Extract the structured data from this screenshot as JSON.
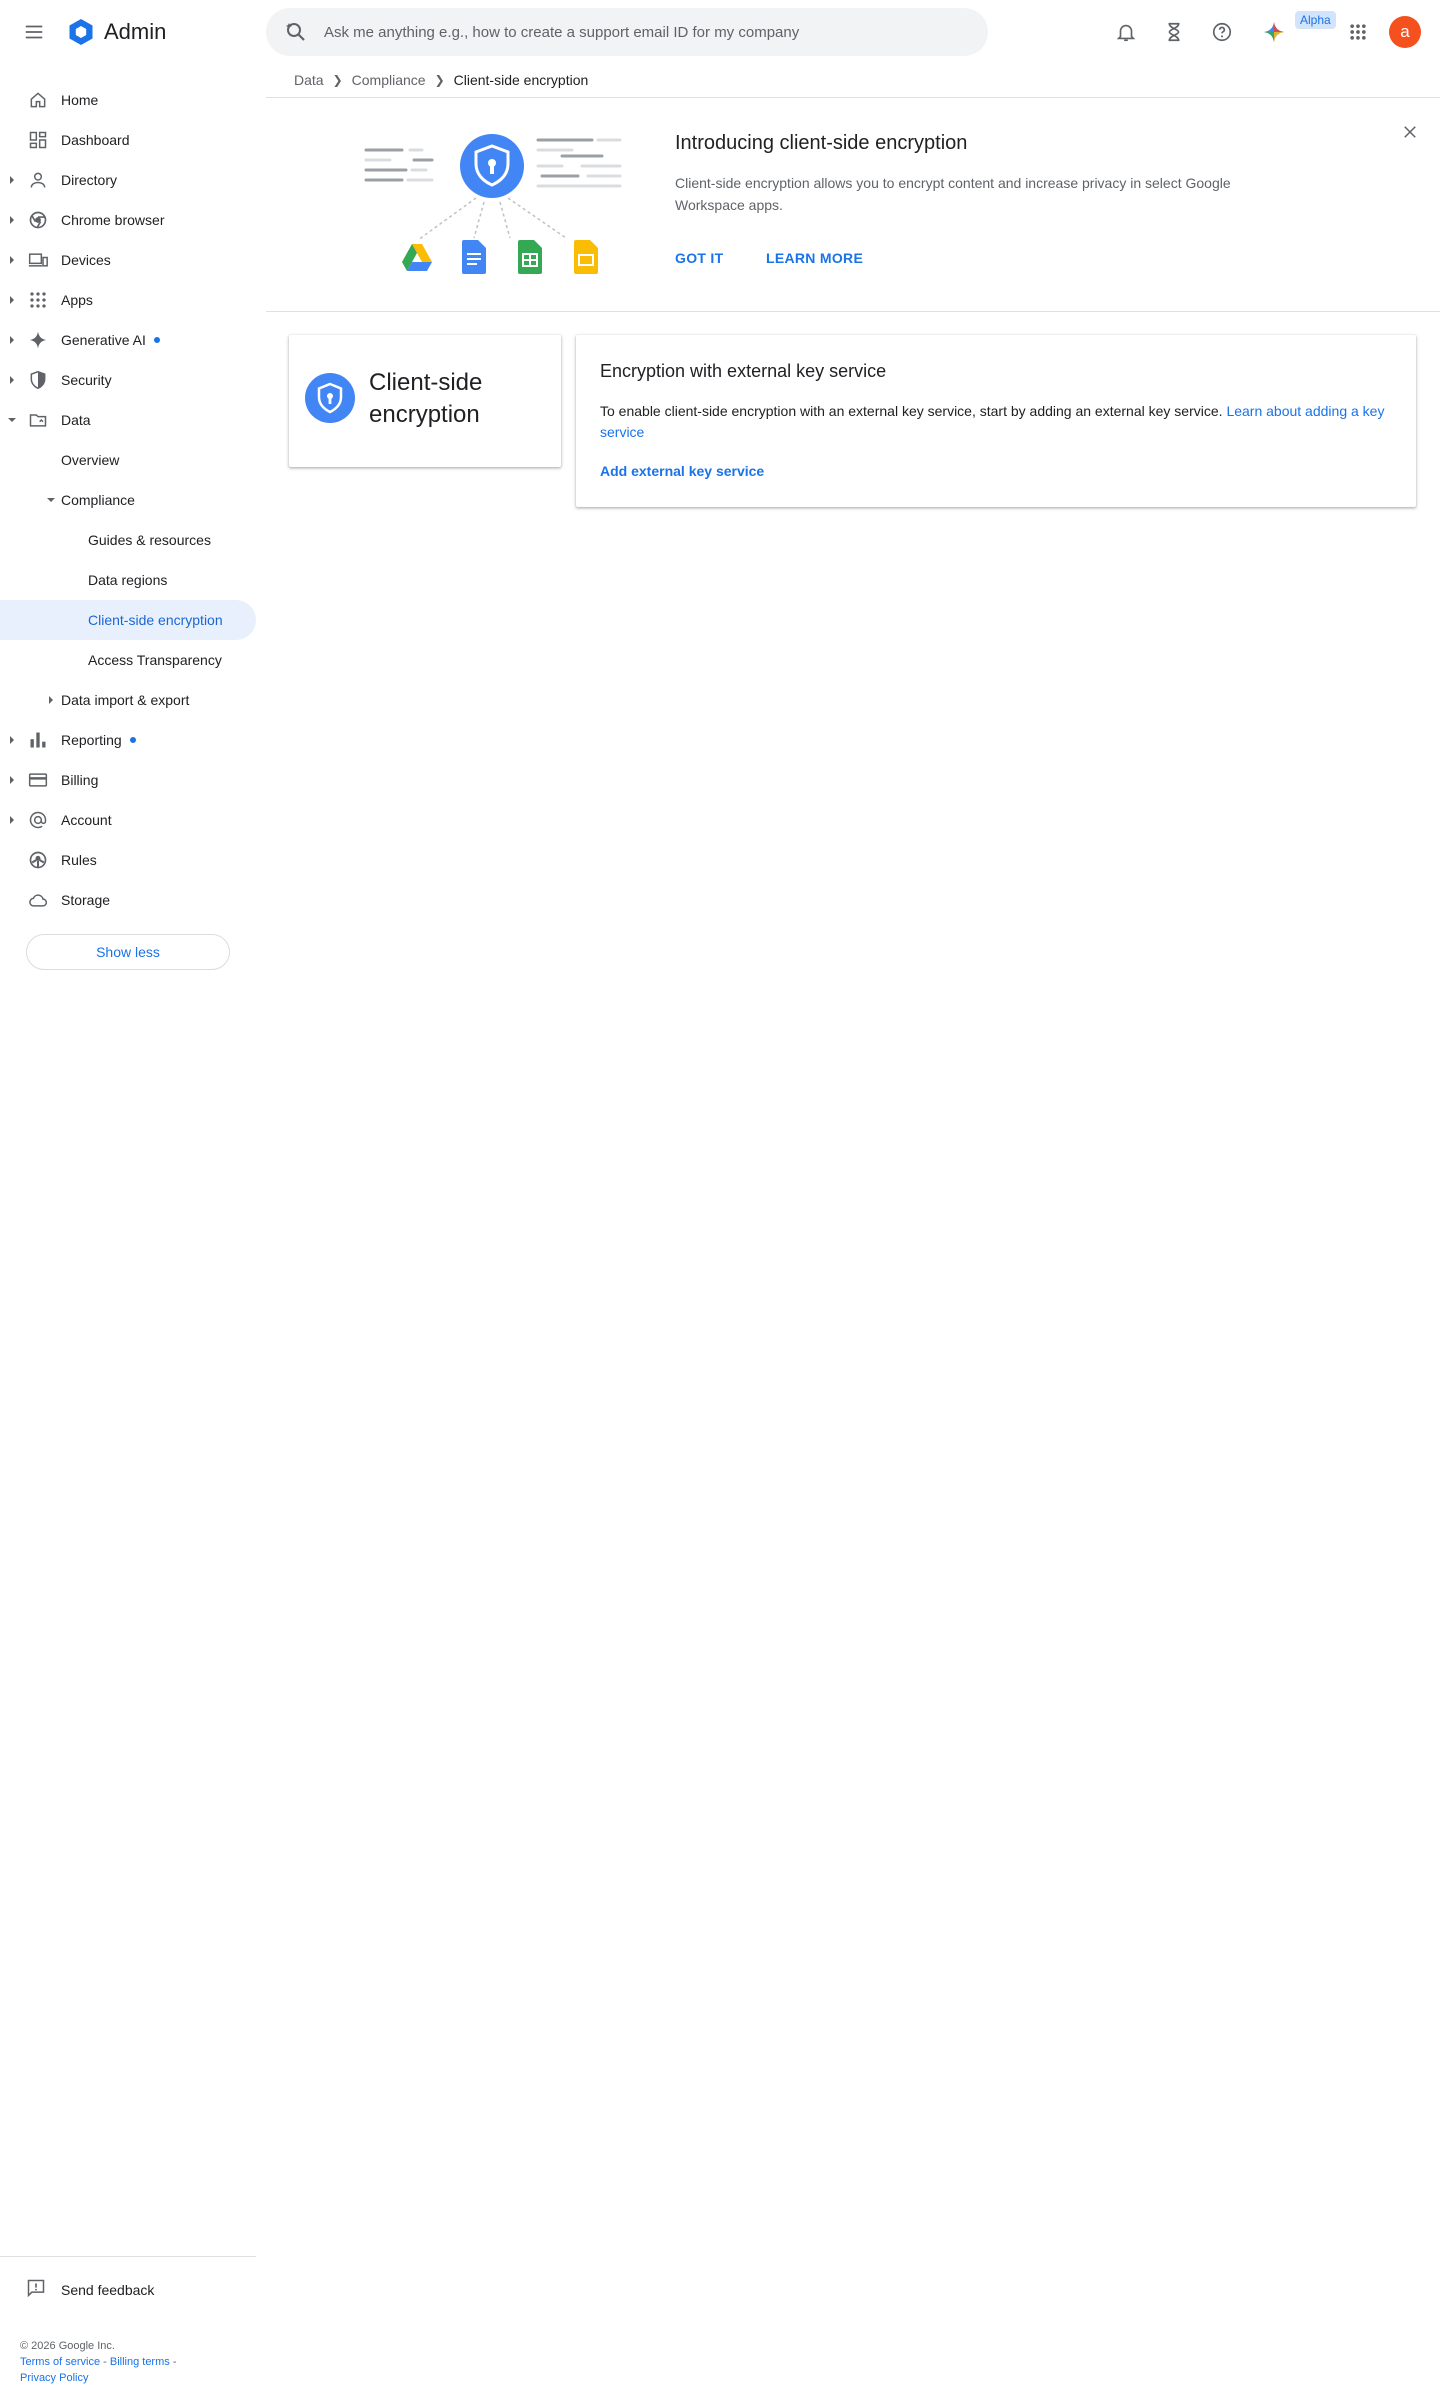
{
  "header": {
    "app_name": "Admin",
    "search_placeholder": "Ask me anything e.g., how to create a support email ID for my company",
    "alpha_badge": "Alpha",
    "avatar_initial": "a"
  },
  "sidebar": {
    "items": [
      {
        "label": "Home",
        "icon": "home-icon"
      },
      {
        "label": "Dashboard",
        "icon": "dashboard-icon"
      },
      {
        "label": "Directory",
        "icon": "person-icon"
      },
      {
        "label": "Chrome browser",
        "icon": "chrome-icon"
      },
      {
        "label": "Devices",
        "icon": "devices-icon"
      },
      {
        "label": "Apps",
        "icon": "apps-grid-icon"
      },
      {
        "label": "Generative AI",
        "icon": "sparkle-icon"
      },
      {
        "label": "Security",
        "icon": "shield-icon"
      },
      {
        "label": "Data",
        "icon": "folder-icon"
      },
      {
        "label": "Overview"
      },
      {
        "label": "Compliance"
      },
      {
        "label": "Guides & resources"
      },
      {
        "label": "Data regions"
      },
      {
        "label": "Client-side encryption"
      },
      {
        "label": "Access Transparency"
      },
      {
        "label": "Data import & export"
      },
      {
        "label": "Reporting",
        "icon": "bar-chart-icon"
      },
      {
        "label": "Billing",
        "icon": "credit-card-icon"
      },
      {
        "label": "Account",
        "icon": "at-sign-icon"
      },
      {
        "label": "Rules",
        "icon": "rules-icon"
      },
      {
        "label": "Storage",
        "icon": "cloud-icon"
      }
    ],
    "show_less": "Show less",
    "send_feedback": "Send feedback"
  },
  "footer": {
    "copyright": "© 2026 Google Inc.",
    "terms": "Terms of service",
    "separator": " - ",
    "billing_terms": "Billing terms",
    "privacy": "Privacy Policy"
  },
  "breadcrumb": {
    "items": [
      "Data",
      "Compliance",
      "Client-side encryption"
    ]
  },
  "banner": {
    "title": "Introducing client-side encryption",
    "description": "Client-side encryption allows you to encrypt content and increase privacy in select Google Workspace apps.",
    "got_it": "GOT IT",
    "learn_more": "LEARN MORE"
  },
  "cse_card": {
    "title": "Client-side encryption"
  },
  "key_service_card": {
    "title": "Encryption with external key service",
    "description": "To enable client-side encryption with an external key service, start by adding an external key service.",
    "learn_link": "Learn about adding a key service",
    "add_link": "Add external key service"
  },
  "colors": {
    "accent": "#1a73e8",
    "active_bg": "#e8f0fe",
    "avatar": "#f4511e",
    "drive_green": "#34a853",
    "docs_blue": "#4285f4",
    "sheets_green": "#34a853",
    "slides_yellow": "#fbbc04"
  }
}
